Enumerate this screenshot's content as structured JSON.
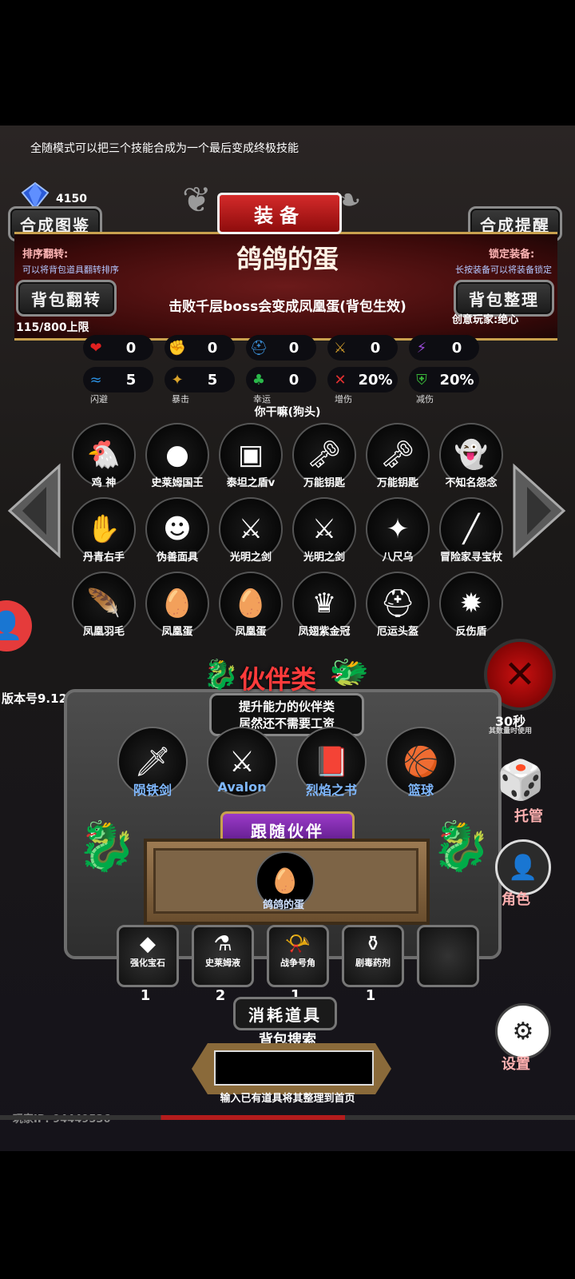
{
  "top_tip": "全随模式可以把三个技能合成为一个最后变成终极技能",
  "gem_count": "4150",
  "header": {
    "title": "装备",
    "left_button": "合成图鉴",
    "right_button": "合成提醒"
  },
  "sort_flip": {
    "label": "排序翻转:",
    "hint": "可以将背包道具翻转排序"
  },
  "lock_equip": {
    "label": "锁定装备:",
    "hint": "长按装备可以将装备锁定"
  },
  "item_name": "鸽鸽的蛋",
  "bag_flip_button": "背包翻转",
  "bag_sort_button": "背包整理",
  "item_desc": "击败千层boss会变成凤凰蛋(背包生效)",
  "bag_capacity": "115/800上限",
  "creative_player": "创意玩家:绝心",
  "stats_row1": [
    {
      "icon": "heart-icon",
      "symbol": "❤",
      "color": "#e02020",
      "value": "0"
    },
    {
      "icon": "strength-icon",
      "symbol": "✊",
      "color": "#d8b22a",
      "value": "0"
    },
    {
      "icon": "helmet-icon",
      "symbol": "⛑",
      "color": "#3a8fd8",
      "value": "0"
    },
    {
      "icon": "sword-icon",
      "symbol": "⚔",
      "color": "#c8962a",
      "value": "0"
    },
    {
      "icon": "lightning-icon",
      "symbol": "⚡",
      "color": "#9a4ad8",
      "value": "0"
    }
  ],
  "stats_row2": [
    {
      "icon": "dodge-icon",
      "symbol": "≈",
      "color": "#2a8fe0",
      "value": "5",
      "label": "闪避"
    },
    {
      "icon": "crit-icon",
      "symbol": "✦",
      "color": "#d8a22a",
      "value": "5",
      "label": "暴击"
    },
    {
      "icon": "clover-icon",
      "symbol": "♣",
      "color": "#2ab84a",
      "value": "0",
      "label": "幸运"
    },
    {
      "icon": "damage-icon",
      "symbol": "✕",
      "color": "#e03030",
      "value": "20%",
      "label": "增伤"
    },
    {
      "icon": "shield-icon",
      "symbol": "⛨",
      "color": "#3ab83a",
      "value": "20%",
      "label": "减伤"
    }
  ],
  "set_name": "你干嘛(狗头)",
  "inventory": [
    {
      "label": "鸡 神",
      "icon": "chicken-icon",
      "symbol": "🐔"
    },
    {
      "label": "史莱姆国王",
      "icon": "slime-icon",
      "symbol": "●"
    },
    {
      "label": "泰坦之盾v",
      "icon": "shield-item-icon",
      "symbol": "▣"
    },
    {
      "label": "万能钥匙",
      "icon": "key-icon",
      "symbol": "🗝"
    },
    {
      "label": "万能钥匙",
      "icon": "key-icon",
      "symbol": "🗝"
    },
    {
      "label": "不知名怨念",
      "icon": "ghost-icon",
      "symbol": "👻"
    },
    {
      "label": "丹青右手",
      "icon": "glove-icon",
      "symbol": "✋"
    },
    {
      "label": "伪善面具",
      "icon": "mask-icon",
      "symbol": "☻"
    },
    {
      "label": "光明之剑",
      "icon": "sword-item-icon",
      "symbol": "⚔"
    },
    {
      "label": "光明之剑",
      "icon": "sword-item-icon",
      "symbol": "⚔"
    },
    {
      "label": "八尺乌",
      "icon": "crow-icon",
      "symbol": "✦"
    },
    {
      "label": "冒险家寻宝杖",
      "icon": "staff-icon",
      "symbol": "╱"
    },
    {
      "label": "凤凰羽毛",
      "icon": "feather-icon",
      "symbol": "🪶"
    },
    {
      "label": "凤凰蛋",
      "icon": "egg-icon",
      "symbol": "🥚"
    },
    {
      "label": "凤凰蛋",
      "icon": "egg-icon",
      "symbol": "🥚"
    },
    {
      "label": "凤翅紫金冠",
      "icon": "crown-icon",
      "symbol": "♛"
    },
    {
      "label": "厄运头盔",
      "icon": "helmet-item-icon",
      "symbol": "⛑"
    },
    {
      "label": "反伤盾",
      "icon": "spike-shield-icon",
      "symbol": "✹"
    }
  ],
  "version": "版本号9.12",
  "partner": {
    "title": "伙伴类",
    "desc_line1": "提升能力的伙伴类",
    "desc_line2": "居然还不需要工资",
    "items": [
      {
        "label": "陨铁剑",
        "icon": "meteor-sword-icon",
        "symbol": "🗡"
      },
      {
        "label": "Avalon",
        "icon": "avalon-icon",
        "symbol": "⚔"
      },
      {
        "label": "烈焰之书",
        "icon": "book-icon",
        "symbol": "📕"
      },
      {
        "label": "篮球",
        "icon": "basketball-icon",
        "symbol": "🏀"
      }
    ],
    "follow_title": "跟随伙伴",
    "follow_item": "鸽鸽的蛋"
  },
  "consumables_title": "消耗道具",
  "consumables": [
    {
      "label": "强化宝石",
      "icon": "gem-icon",
      "symbol": "◆",
      "count": "1"
    },
    {
      "label": "史莱姆液",
      "icon": "potion-icon",
      "symbol": "⚗",
      "count": "2"
    },
    {
      "label": "战争号角",
      "icon": "horn-icon",
      "symbol": "📯",
      "count": "1"
    },
    {
      "label": "剧毒药剂",
      "icon": "poison-icon",
      "symbol": "⚱",
      "count": "1"
    }
  ],
  "search": {
    "title": "背包搜索",
    "hint": "输入已有道具将其整理到首页",
    "value": ""
  },
  "side": {
    "manage_label": "托管",
    "character_label": "角色",
    "settings_label": "设置",
    "timer_text": "30秒",
    "timer_hint": "其数量时使用"
  },
  "player_ip": "玩家IP: 94449536"
}
